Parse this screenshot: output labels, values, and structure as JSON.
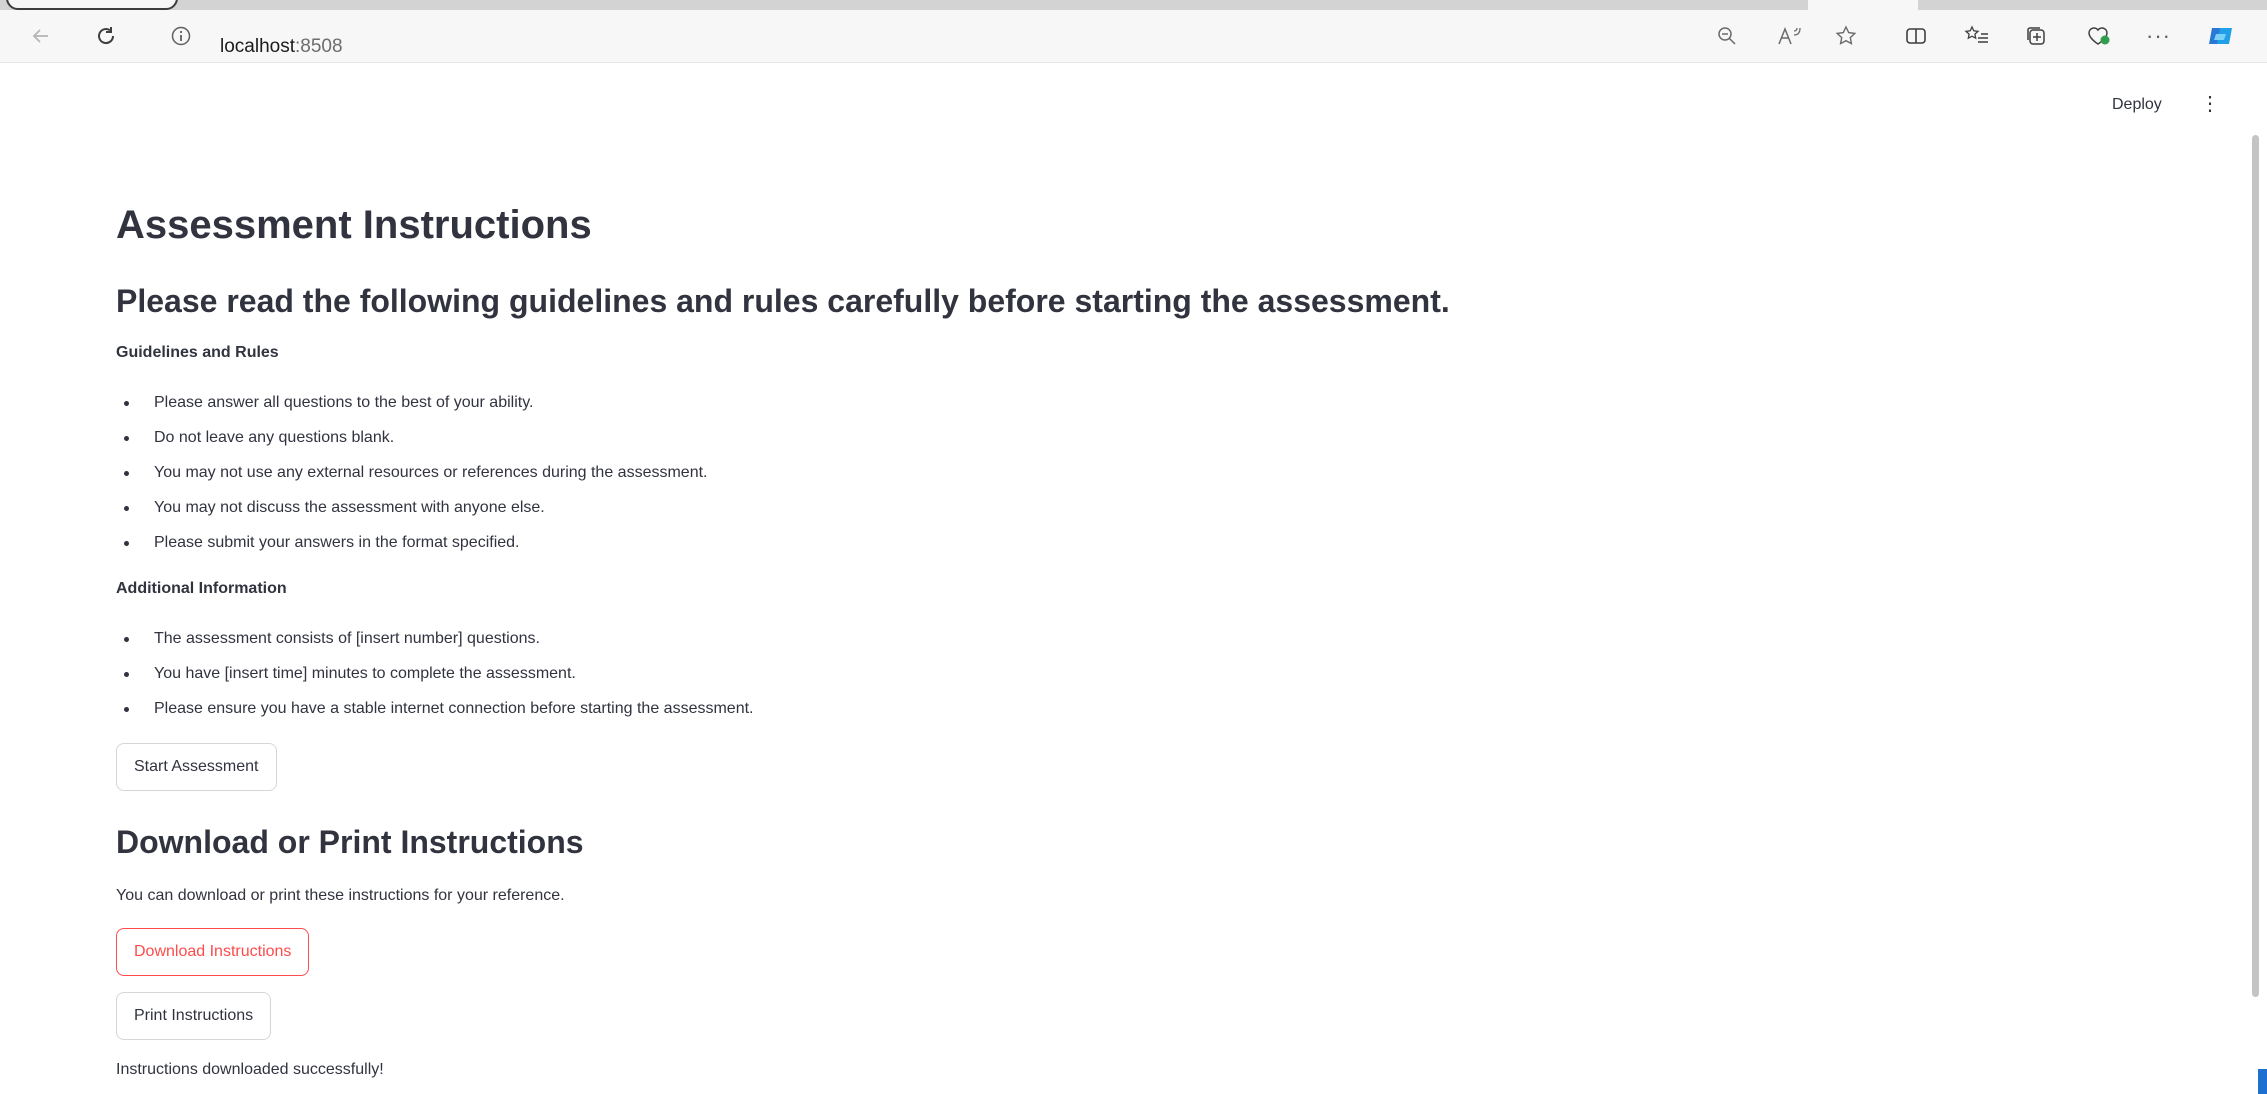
{
  "browser": {
    "url_host": "localhost",
    "url_port": ":8508",
    "icons": [
      "back-arrow-icon",
      "refresh-icon",
      "info-icon",
      "zoom-out-icon",
      "read-aloud-icon",
      "favorite-star-icon",
      "split-screen-icon",
      "favorites-list-icon",
      "collections-icon",
      "browser-essentials-icon",
      "more-icon",
      "copilot-icon"
    ]
  },
  "app_header": {
    "deploy_label": "Deploy",
    "menu_glyph": "⋮"
  },
  "page": {
    "title": "Assessment Instructions",
    "subtitle": "Please read the following guidelines and rules carefully before starting the assessment.",
    "guidelines_heading": "Guidelines and Rules",
    "guidelines": [
      "Please answer all questions to the best of your ability.",
      "Do not leave any questions blank.",
      "You may not use any external resources or references during the assessment.",
      "You may not discuss the assessment with anyone else.",
      "Please submit your answers in the format specified."
    ],
    "additional_heading": "Additional Information",
    "additional": [
      "The assessment consists of [insert number] questions.",
      "You have [insert time] minutes to complete the assessment.",
      "Please ensure you have a stable internet connection before starting the assessment."
    ],
    "start_button": "Start Assessment",
    "download_section_title": "Download or Print Instructions",
    "download_section_text": "You can download or print these instructions for your reference.",
    "download_button": "Download Instructions",
    "print_button": "Print Instructions",
    "status_message": "Instructions downloaded successfully!"
  },
  "colors": {
    "accent": "#ff4b4b",
    "text": "#31333f",
    "border": "#d6d6d9"
  }
}
